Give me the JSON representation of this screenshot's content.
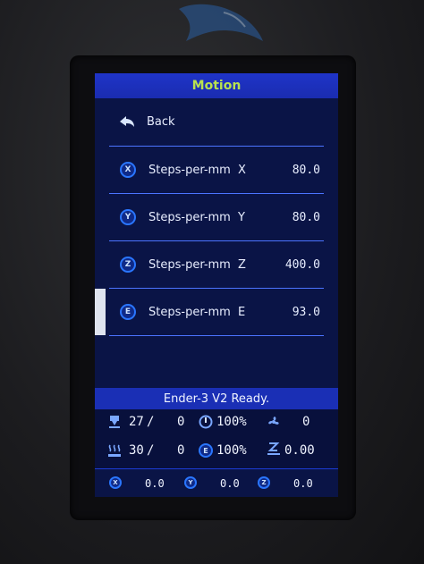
{
  "title": "Motion",
  "menu": {
    "back_label": "Back",
    "items": [
      {
        "label": "Steps-per-mm",
        "axis": "X",
        "value": "80.0",
        "icon": "X"
      },
      {
        "label": "Steps-per-mm",
        "axis": "Y",
        "value": "80.0",
        "icon": "Y"
      },
      {
        "label": "Steps-per-mm",
        "axis": "Z",
        "value": "400.0",
        "icon": "Z"
      },
      {
        "label": "Steps-per-mm",
        "axis": "E",
        "value": "93.0",
        "icon": "E"
      }
    ]
  },
  "status": {
    "message": "Ender-3 V2 Ready.",
    "hotend_current": "27",
    "hotend_sep": "/",
    "hotend_target": "0",
    "feedrate": "100%",
    "fan": "0",
    "bed_current": "30",
    "bed_sep": "/",
    "bed_target": "0",
    "flow": "100%",
    "z_offset": "0.00"
  },
  "coords": {
    "x_label": "X",
    "x": "0.0",
    "y_label": "Y",
    "y": "0.0",
    "z_label": "Z",
    "z": "0.0"
  },
  "colors": {
    "accent": "#b8e24f",
    "header": "#1f34c8",
    "background": "#0a1446",
    "divider": "#4b74ff"
  }
}
